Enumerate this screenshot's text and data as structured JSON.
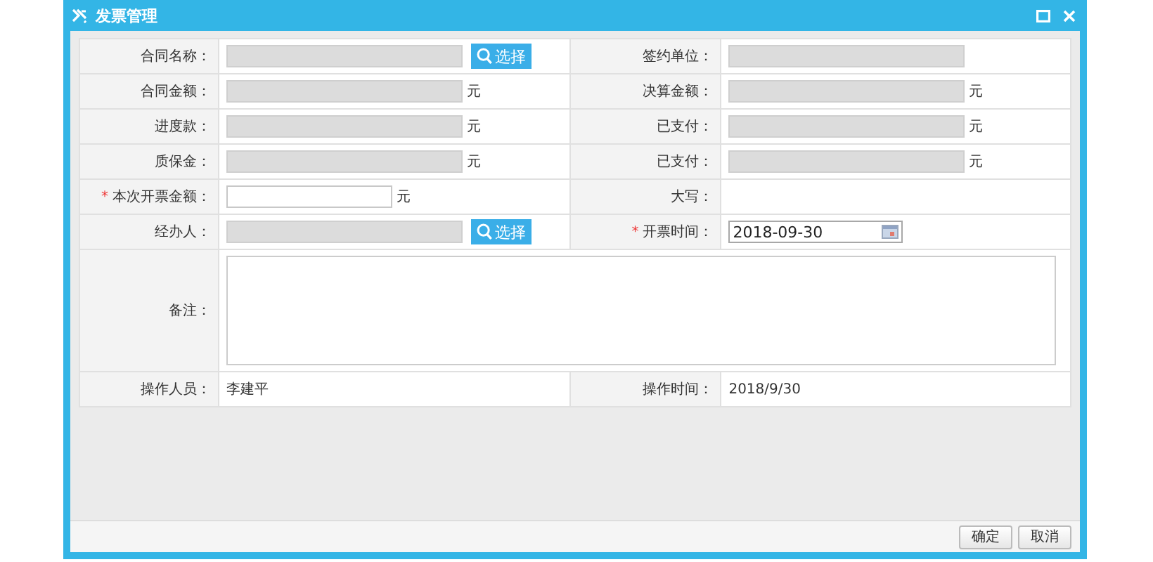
{
  "window": {
    "title": "发票管理"
  },
  "required_mark": "*",
  "rows": [
    {
      "cells": [
        {
          "label": "合同名称：",
          "required": false,
          "field": {
            "kind": "readonly",
            "button": "选择"
          }
        },
        {
          "label": "签约单位：",
          "required": false,
          "field": {
            "kind": "readonly"
          }
        }
      ]
    },
    {
      "cells": [
        {
          "label": "合同金额：",
          "required": false,
          "field": {
            "kind": "readonly",
            "unit": "元"
          }
        },
        {
          "label": "决算金额：",
          "required": false,
          "field": {
            "kind": "readonly",
            "unit": "元"
          }
        }
      ]
    },
    {
      "cells": [
        {
          "label": "进度款：",
          "required": false,
          "field": {
            "kind": "readonly",
            "unit": "元"
          }
        },
        {
          "label": "已支付：",
          "required": false,
          "field": {
            "kind": "readonly",
            "unit": "元"
          }
        }
      ]
    },
    {
      "cells": [
        {
          "label": "质保金：",
          "required": false,
          "field": {
            "kind": "readonly",
            "unit": "元"
          }
        },
        {
          "label": "已支付：",
          "required": false,
          "field": {
            "kind": "readonly",
            "unit": "元"
          }
        }
      ]
    },
    {
      "cells": [
        {
          "label": "本次开票金额：",
          "required": true,
          "field": {
            "kind": "input",
            "unit": "元"
          }
        },
        {
          "label": "大写：",
          "required": false,
          "field": {
            "kind": "text"
          }
        }
      ]
    },
    {
      "cells": [
        {
          "label": "经办人：",
          "required": false,
          "field": {
            "kind": "readonly",
            "button": "选择"
          }
        },
        {
          "label": "开票时间：",
          "required": true,
          "field": {
            "kind": "date",
            "value": "2018-09-30"
          }
        }
      ]
    },
    {
      "cells": [
        {
          "label": "备注：",
          "required": false,
          "field": {
            "kind": "textarea"
          }
        }
      ]
    },
    {
      "cells": [
        {
          "label": "操作人员：",
          "required": false,
          "field": {
            "kind": "text",
            "value": "李建平"
          }
        },
        {
          "label": "操作时间：",
          "required": false,
          "field": {
            "kind": "text",
            "value": "2018/9/30"
          }
        }
      ]
    }
  ],
  "buttons": [
    "确定",
    "取消"
  ]
}
